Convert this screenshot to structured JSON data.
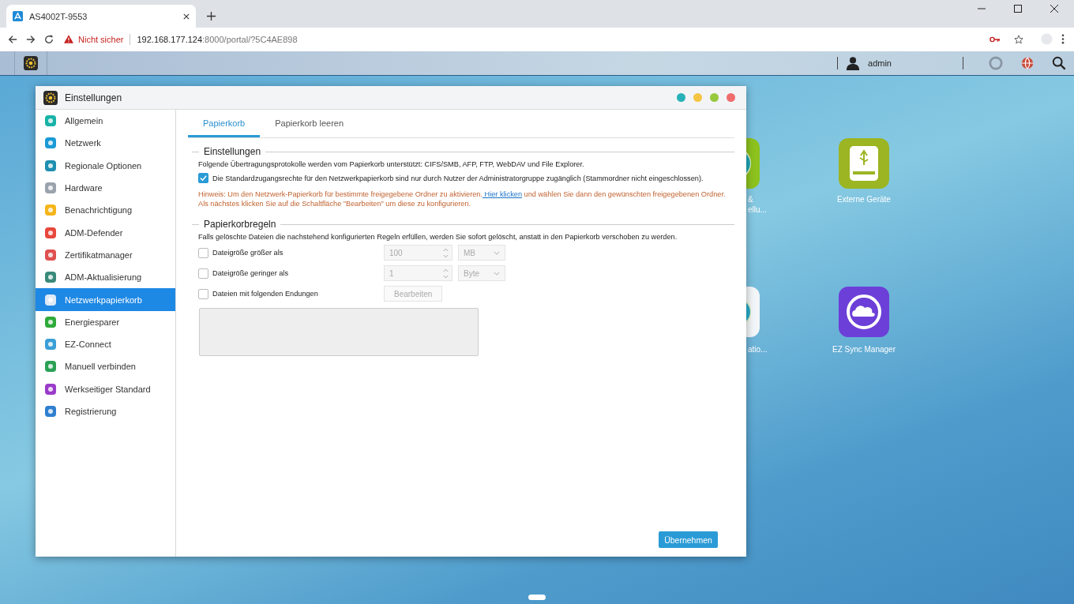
{
  "browser": {
    "tab_title": "AS4002T-9553",
    "security": "Nicht sicher",
    "url_host": "192.168.177.124",
    "url_rest": ":8000/portal/?5C4AE898"
  },
  "taskbar": {
    "user": "admin"
  },
  "desktop_icons": [
    {
      "kind": "partial",
      "color": "#8dc21f",
      "label_lines": [
        "&",
        "ellu..."
      ]
    },
    {
      "kind": "drive",
      "color": "#9bb523",
      "label_lines": [
        "Externe Geräte"
      ]
    },
    {
      "kind": "partial",
      "color": "#f2f6f8",
      "label_lines": [
        "atio..."
      ]
    },
    {
      "kind": "sync",
      "color": "#6c3fd8",
      "label_lines": [
        "EZ Sync Manager"
      ]
    }
  ],
  "window": {
    "title": "Einstellungen"
  },
  "sidebar": {
    "items": [
      {
        "label": "Allgemein",
        "selected": false
      },
      {
        "label": "Netzwerk",
        "selected": false
      },
      {
        "label": "Regionale Optionen",
        "selected": false
      },
      {
        "label": "Hardware",
        "selected": false
      },
      {
        "label": "Benachrichtigung",
        "selected": false
      },
      {
        "label": "ADM-Defender",
        "selected": false
      },
      {
        "label": "Zertifikatmanager",
        "selected": false
      },
      {
        "label": "ADM-Aktualisierung",
        "selected": false
      },
      {
        "label": "Netzwerkpapierkorb",
        "selected": true
      },
      {
        "label": "Energiesparer",
        "selected": false
      },
      {
        "label": "EZ-Connect",
        "selected": false
      },
      {
        "label": "Manuell verbinden",
        "selected": false
      },
      {
        "label": "Werkseitiger Standard",
        "selected": false
      },
      {
        "label": "Registrierung",
        "selected": false
      }
    ]
  },
  "tabs": [
    {
      "label": "Papierkorb",
      "selected": true
    },
    {
      "label": "Papierkorb leeren",
      "selected": false
    }
  ],
  "settings_section": {
    "title": "Einstellungen",
    "description": "Folgende Übertragungsprotokolle werden vom Papierkorb unterstützt: CIFS/SMB, AFP, FTP, WebDAV und File Explorer.",
    "access_option": {
      "label": "Die Standardzugangsrechte für den Netzwerkpapierkorb sind nur durch Nutzer der Administratorgruppe zugänglich (Stammordner nicht eingeschlossen).",
      "checked": true
    },
    "hint_before": "Hinweis: Um den Netzwerk-Papierkorb für bestimmte freigegebene Ordner zu aktivieren.",
    "hint_link": " Hier klicken",
    "hint_after": " und wählen Sie dann den gewünschten freigegebenen Ordner.",
    "hint_second_line": "Als nächstes klicken Sie auf die Schaltfläche \"Bearbeiten\" um diese zu konfigurieren."
  },
  "rules_section": {
    "title": "Papierkorbregeln",
    "description": "Falls gelöschte Dateien die nachstehend konfigurierten Regeln erfüllen, werden Sie sofort gelöscht, anstatt in den Papierkorb verschoben zu werden.",
    "rules": [
      {
        "kind": "size",
        "label": "Dateigröße größer als",
        "checked": false,
        "value": "100",
        "unit": "MB"
      },
      {
        "kind": "size",
        "label": "Dateigröße geringer als",
        "checked": false,
        "value": "1",
        "unit": "Byte"
      },
      {
        "kind": "extensions",
        "label": "Dateien mit folgenden Endungen",
        "checked": false,
        "button": "Bearbeiten"
      }
    ]
  },
  "apply_button": "Übernehmen"
}
